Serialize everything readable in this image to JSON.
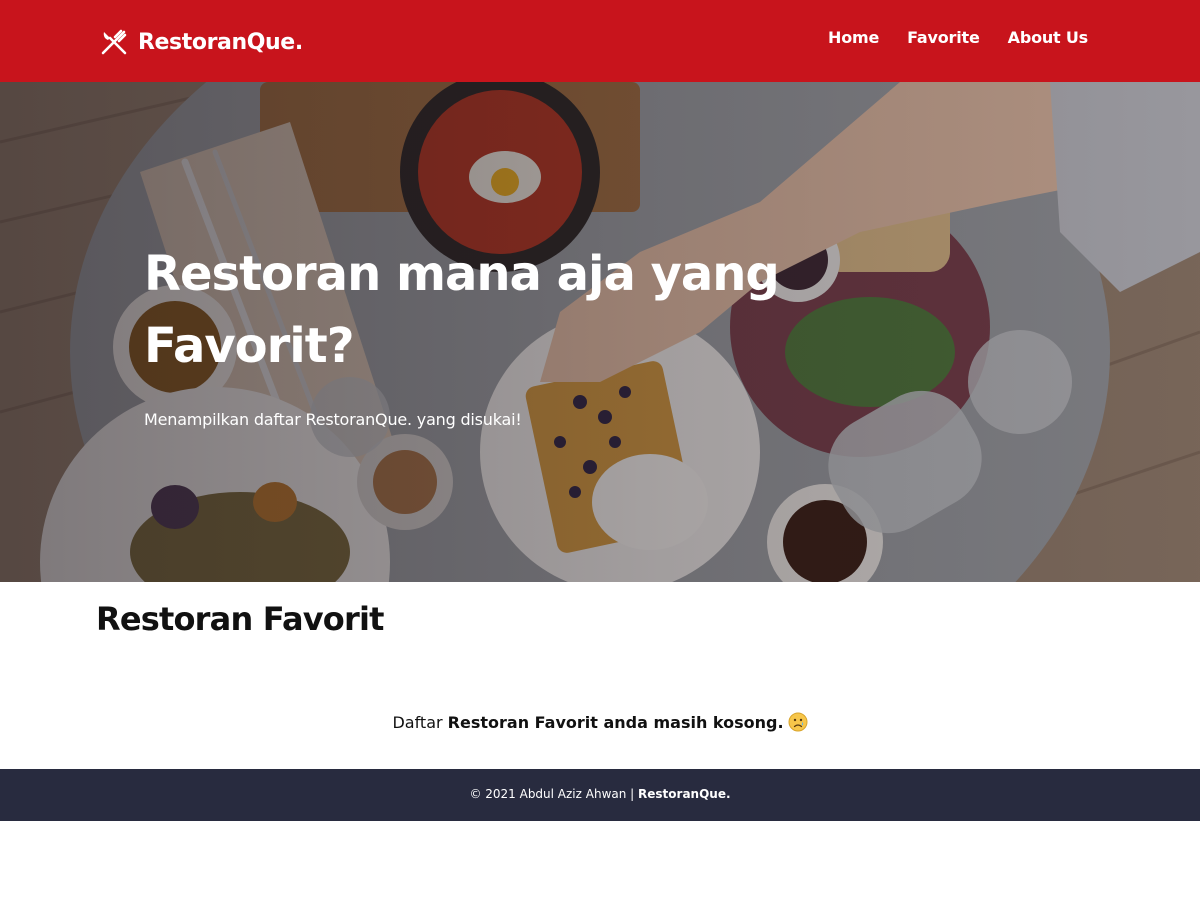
{
  "header": {
    "brand": "RestoranQue.",
    "brand_icon": "fork-knife-icon",
    "background_color": "#c8141c",
    "nav": [
      {
        "label": "Home"
      },
      {
        "label": "Favorite"
      },
      {
        "label": "About Us"
      }
    ]
  },
  "hero": {
    "title": "Restoran mana aja yang Favorit?",
    "subtitle": "Menampilkan daftar RestoranQue. yang disukai!",
    "image_subject": "food-table-photo"
  },
  "main": {
    "title": "Restoran Favorit",
    "empty_prefix": "Daftar ",
    "empty_bold": "Restoran Favorit anda masih kosong.",
    "empty_icon": "sad-face-icon"
  },
  "footer": {
    "copyright": "© 2021 Abdul Aziz Ahwan | ",
    "brand": "RestoranQue.",
    "background_color": "#282b3f"
  }
}
